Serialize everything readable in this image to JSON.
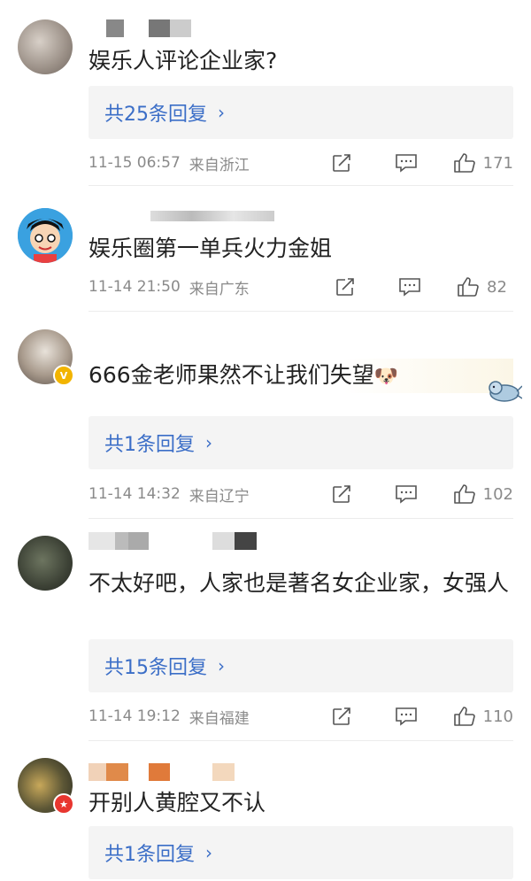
{
  "comments": [
    {
      "text": "娱乐人评论企业家?",
      "replies": "共25条回复",
      "time": "11-15 06:57",
      "location": "来自浙江",
      "likes": "171"
    },
    {
      "text": "娱乐圈第一单兵火力金姐",
      "replies": "",
      "time": "11-14 21:50",
      "location": "来自广东",
      "likes": "82"
    },
    {
      "text": "666金老师果然不让我们失望",
      "emoji": "🐶",
      "replies": "共1条回复",
      "time": "11-14 14:32",
      "location": "来自辽宁",
      "likes": "102"
    },
    {
      "text": "不太好吧，人家也是著名女企业家，女强人",
      "replies": "共15条回复",
      "time": "11-14 19:12",
      "location": "来自福建",
      "likes": "110"
    },
    {
      "text": "开别人黄腔又不认",
      "replies": "共1条回复"
    }
  ],
  "icons": {
    "chevron": "›",
    "verified_badge": "V",
    "flag_badge": "★"
  },
  "colors": {
    "link_blue": "#3b6ec7",
    "meta_gray": "#8a8a8a"
  }
}
